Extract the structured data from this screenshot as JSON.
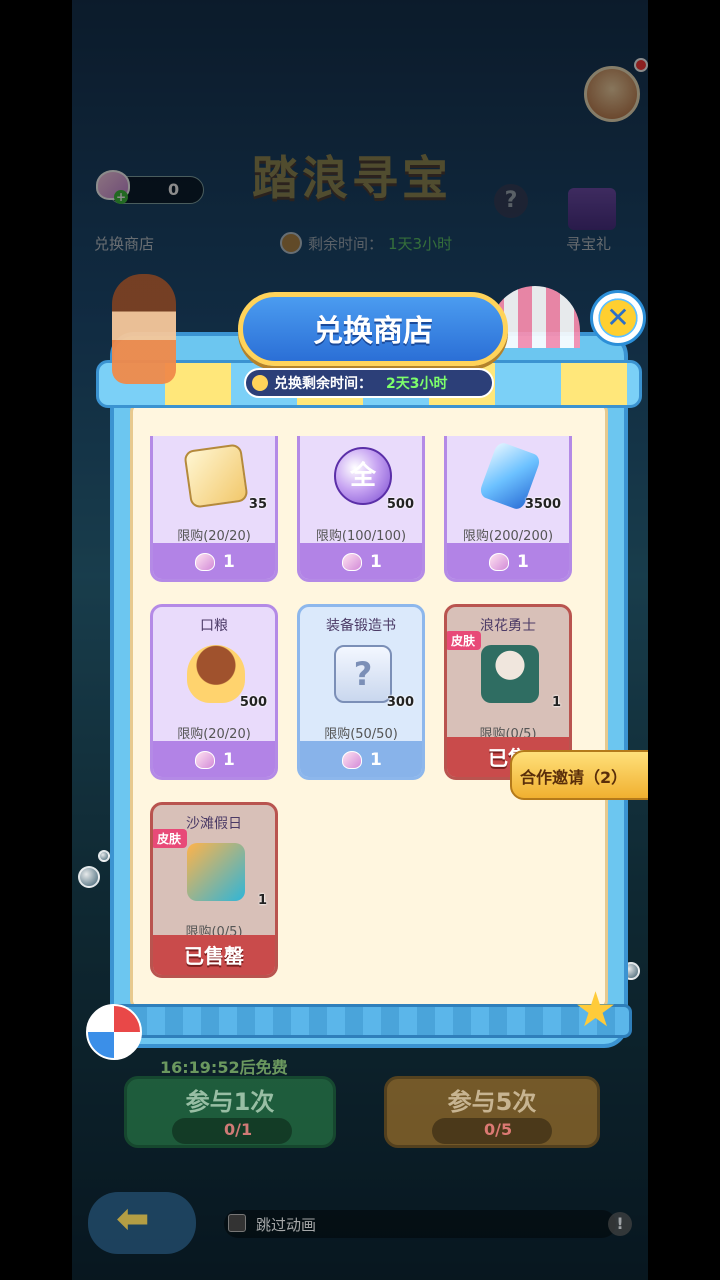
{
  "hud": {
    "event_title": "踏浪寻宝",
    "help_icon": "question-icon",
    "currency_value": "0",
    "shop_label": "兑换商店",
    "timer_label": "剩余时间：",
    "timer_value": "1天3小时",
    "gift_label": "寻宝礼"
  },
  "modal": {
    "title": "兑换商店",
    "countdown_label": "兑换剩余时间：",
    "countdown_value": "2天3小时",
    "close_icon": "close-icon"
  },
  "items": [
    {
      "name": "",
      "icon": "ticket-icon",
      "qty": "35",
      "limit": "限购(20/20)",
      "price": "1",
      "style": "purple"
    },
    {
      "name": "",
      "icon": "coin-icon",
      "coin_text": "全",
      "qty": "500",
      "limit": "限购(100/100)",
      "price": "1",
      "style": "purple"
    },
    {
      "name": "",
      "icon": "crystal-icon",
      "qty": "3500",
      "limit": "限购(200/200)",
      "price": "1",
      "style": "purple"
    },
    {
      "name": "口粮",
      "icon": "pet-food-icon",
      "qty": "500",
      "limit": "限购(20/20)",
      "price": "1",
      "style": "purple"
    },
    {
      "name": "装备锻造书",
      "icon": "scroll-icon",
      "qty": "300",
      "limit": "限购(50/50)",
      "price": "1",
      "style": "blue"
    },
    {
      "name": "浪花勇士",
      "icon": "hero-skin-icon",
      "tag": "皮肤",
      "qty": "1",
      "limit": "限购(0/5)",
      "soldout": "已售",
      "style": "red"
    },
    {
      "name": "沙滩假日",
      "icon": "glasses-skin-icon",
      "tag": "皮肤",
      "qty": "1",
      "limit": "限购(0/5)",
      "soldout": "已售罄",
      "style": "red"
    }
  ],
  "coop": {
    "label": "合作邀请（2）"
  },
  "bottom": {
    "free_label": "16:19:52后免费",
    "btn_one_label": "参与1次",
    "btn_one_count": "0/1",
    "btn_five_label": "参与5次",
    "btn_five_count": "0/5",
    "skip_label": "跳过动画"
  }
}
